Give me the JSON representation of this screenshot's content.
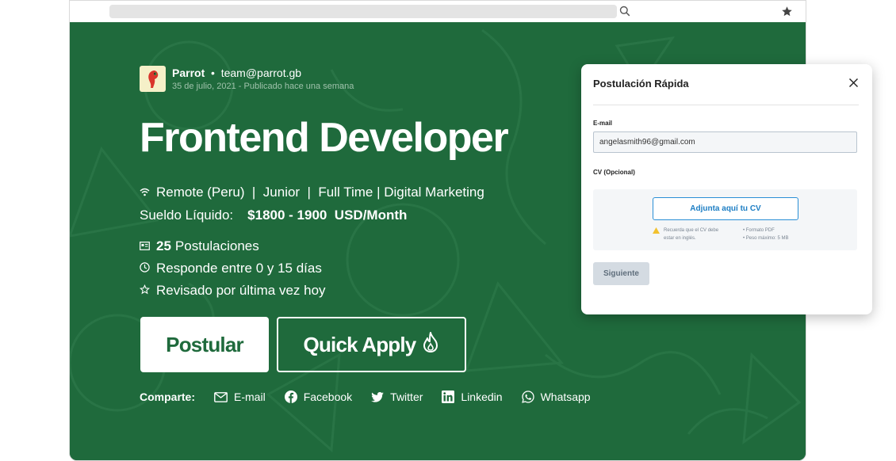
{
  "company": {
    "name": "Parrot",
    "email": "team@parrot.gb",
    "date": "35 de julio, 2021",
    "published": "Publicado hace una semana"
  },
  "job": {
    "title": "Frontend Developer",
    "meta_line": "Remote (Peru)  |  Junior  |  Full Time | Digital Marketing",
    "salary_label": "Sueldo Líquido:",
    "salary_value": "$1800 - 1900  USD/Month",
    "applications_count": "25",
    "applications_label": "Postulaciones",
    "response_time": "Responde entre 0 y 15 días",
    "last_reviewed": "Revisado por última vez hoy"
  },
  "actions": {
    "apply": "Postular",
    "quick_apply": "Quick Apply"
  },
  "share": {
    "label": "Comparte:",
    "items": [
      "E-mail",
      "Facebook",
      "Twitter",
      "Linkedin",
      "Whatsapp"
    ]
  },
  "modal": {
    "title": "Postulación Rápida",
    "email_label": "E-mail",
    "email_value": "angelasmith96@gmail.com",
    "cv_label": "CV (Opcional)",
    "attach_label": "Adjunta aquí tu CV",
    "note_line1": "Recuerda que el CV debe",
    "note_line2": "estar en inglés.",
    "req_format": "• Formato PDF",
    "req_size": "• Peso máximo: 5 MB",
    "next_label": "Siguiente"
  },
  "colors": {
    "hero_bg": "#1f6a3c",
    "accent_blue": "#1d7ec4",
    "warning": "#f2c12e"
  },
  "icons": {
    "url_search": "search-icon",
    "bookmark": "star-icon",
    "modal_close": "close-icon",
    "quick_apply": "flame-icon",
    "location": "wifi-icon",
    "applications": "id-card-icon",
    "response": "clock-icon",
    "reviewed": "star-outline-icon",
    "warning": "warning-icon"
  }
}
